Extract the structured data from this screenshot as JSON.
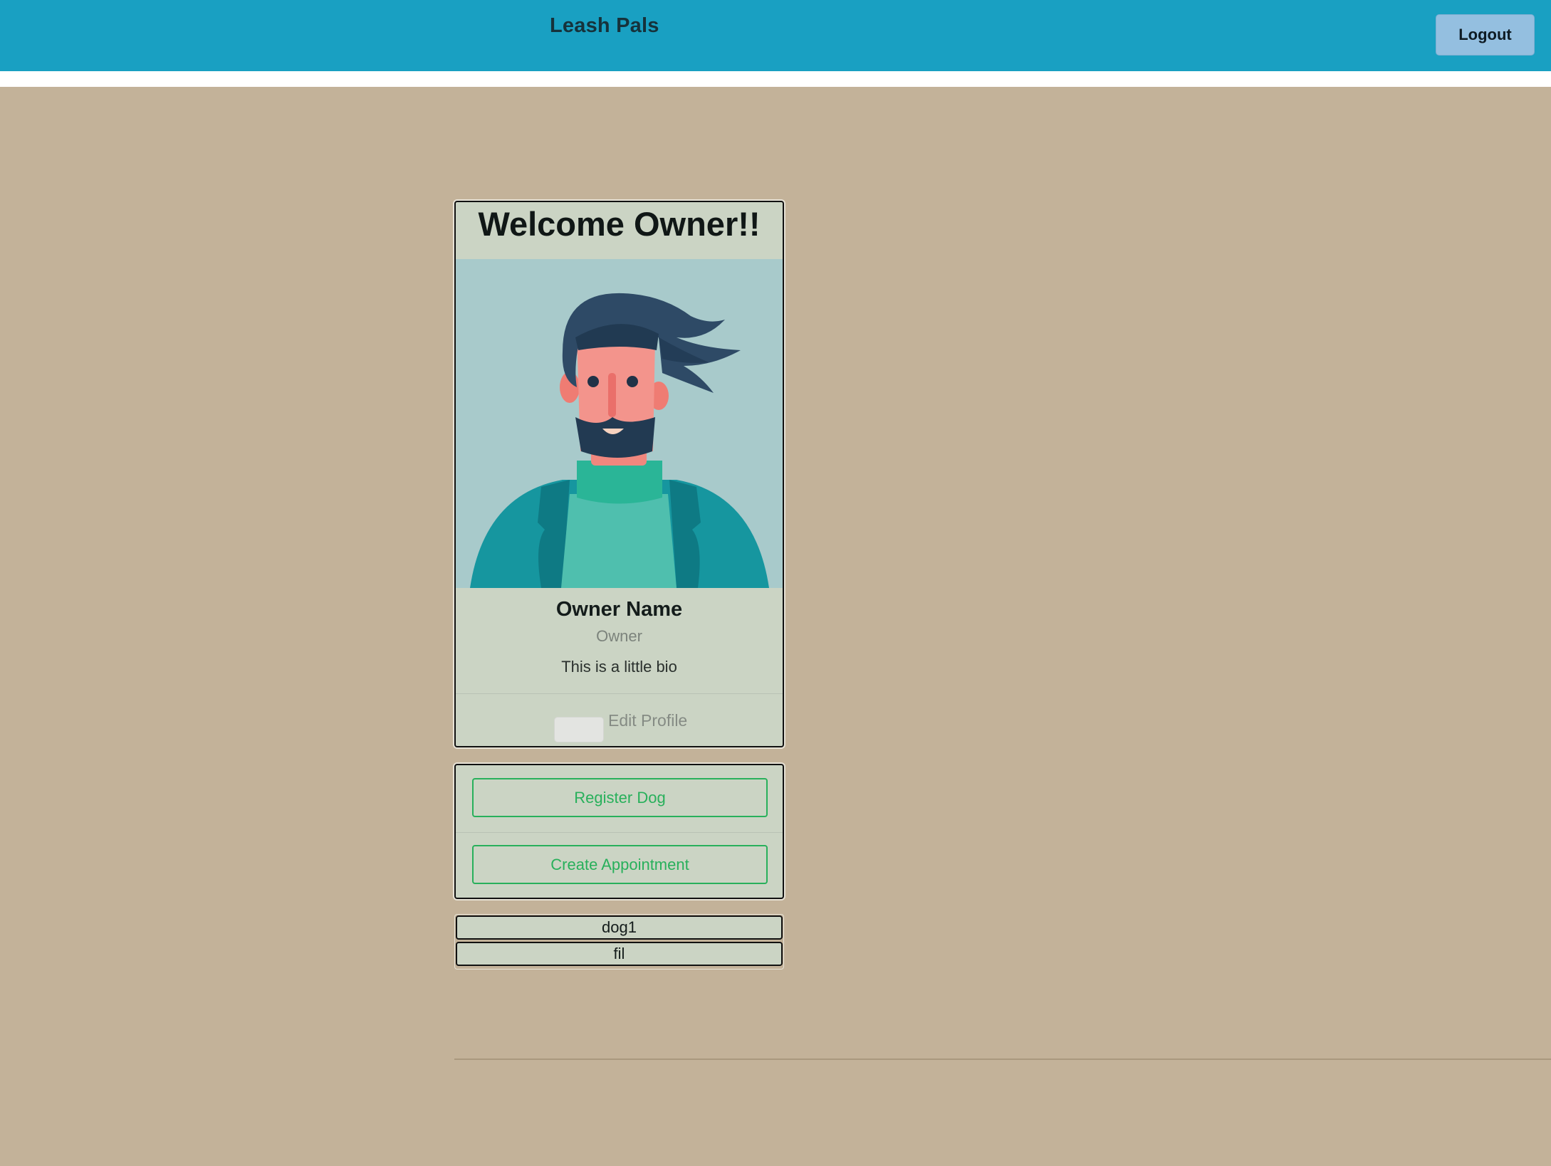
{
  "header": {
    "brand": "Leash Pals",
    "logout_label": "Logout",
    "color": "#19a0c2"
  },
  "profile": {
    "title": "Welcome Owner!!",
    "avatar_icon": "bearded-man-avatar",
    "name": "Owner Name",
    "role": "Owner",
    "bio": "This is a little bio",
    "edit_label": "Edit Profile"
  },
  "actions": {
    "register_label": "Register Dog",
    "appointment_label": "Create Appointment",
    "accent": "#28b05b"
  },
  "dogs": [
    "dog1",
    "fil"
  ],
  "colors": {
    "page_background": "#c3b299",
    "card_background": "#cbd4c4"
  }
}
